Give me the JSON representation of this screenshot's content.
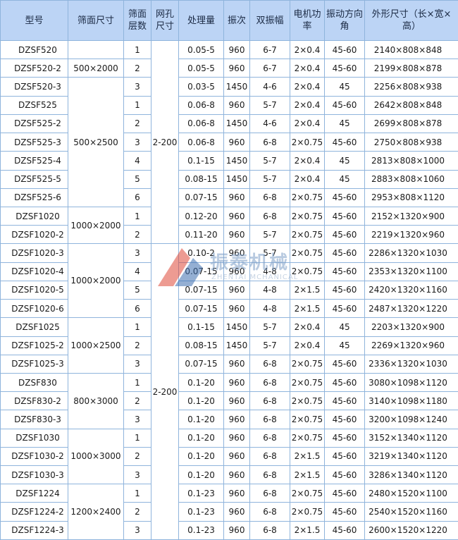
{
  "headers": [
    "型号",
    "筛面尺寸",
    "筛面层数",
    "网孔尺寸",
    "处理量",
    "振次",
    "双振幅",
    "电机功率",
    "振动方向角",
    "外形尺寸（长×宽×高）"
  ],
  "groups": [
    {
      "size": "",
      "rows": [
        {
          "model": "DZSF520",
          "layers": "1",
          "throughput": "0.05-5",
          "freq": "960",
          "amplitude": "6-7",
          "motor": "2×0.4",
          "angle": "45-60",
          "dims": "2140×808×848"
        }
      ]
    },
    {
      "size": "500×2000",
      "rows": [
        {
          "model": "DZSF520-2",
          "layers": "2",
          "throughput": "0.05-5",
          "freq": "960",
          "amplitude": "6-7",
          "motor": "2×0.4",
          "angle": "45-60",
          "dims": "2199×808×878"
        }
      ]
    },
    {
      "size": "500×2500",
      "rows": [
        {
          "model": "DZSF520-3",
          "layers": "3",
          "throughput": "0.03-5",
          "freq": "1450",
          "amplitude": "4-6",
          "motor": "2×0.4",
          "angle": "45",
          "dims": "2256×808×938"
        },
        {
          "model": "DZSF525",
          "layers": "1",
          "throughput": "0.06-8",
          "freq": "960",
          "amplitude": "5-7",
          "motor": "2×0.4",
          "angle": "45-60",
          "dims": "2642×808×848"
        },
        {
          "model": "DZSF525-2",
          "layers": "2",
          "throughput": "0.06-8",
          "freq": "1450",
          "amplitude": "4-6",
          "motor": "2×0.4",
          "angle": "45",
          "dims": "2699×808×878"
        },
        {
          "model": "DZSF525-3",
          "layers": "3",
          "throughput": "0.06-8",
          "freq": "960",
          "amplitude": "6-8",
          "motor": "2×0.75",
          "angle": "45-60",
          "dims": "2750×808×938"
        },
        {
          "model": "DZSF525-4",
          "layers": "4",
          "throughput": "0.1-15",
          "freq": "1450",
          "amplitude": "5-7",
          "motor": "2×0.4",
          "angle": "45",
          "dims": "2813×808×1000"
        },
        {
          "model": "DZSF525-5",
          "layers": "5",
          "throughput": "0.08-15",
          "freq": "1450",
          "amplitude": "5-7",
          "motor": "2×0.4",
          "angle": "45",
          "dims": "2883×808×1060"
        },
        {
          "model": "DZSF525-6",
          "layers": "6",
          "throughput": "0.07-15",
          "freq": "960",
          "amplitude": "6-8",
          "motor": "2×0.75",
          "angle": "45-60",
          "dims": "2953×808×1120"
        }
      ]
    },
    {
      "size": "1000×2000",
      "rows": [
        {
          "model": "DZSF1020",
          "layers": "1",
          "throughput": "0.12-20",
          "freq": "960",
          "amplitude": "6-8",
          "motor": "2×0.75",
          "angle": "45-60",
          "dims": "2152×1320×900"
        },
        {
          "model": "DZSF1020-2",
          "layers": "2",
          "throughput": "0.11-20",
          "freq": "960",
          "amplitude": "5-7",
          "motor": "2×0.75",
          "angle": "45-60",
          "dims": "2219×1320×960"
        }
      ]
    },
    {
      "size": "1000×2000",
      "rows": [
        {
          "model": "DZSF1020-3",
          "layers": "3",
          "throughput": "0.10-2",
          "freq": "960",
          "amplitude": "5-7",
          "motor": "2×0.75",
          "angle": "45-60",
          "dims": "2286×1320×1030"
        },
        {
          "model": "DZSF1020-4",
          "layers": "4",
          "throughput": "0.07-15",
          "freq": "960",
          "amplitude": "4-8",
          "motor": "2×0.75",
          "angle": "45-60",
          "dims": "2353×1320×1100"
        },
        {
          "model": "DZSF1020-5",
          "layers": "5",
          "throughput": "0.07-15",
          "freq": "960",
          "amplitude": "4-8",
          "motor": "2×1.5",
          "angle": "45-60",
          "dims": "2420×1320×1160"
        },
        {
          "model": "DZSF1020-6",
          "layers": "6",
          "throughput": "0.07-15",
          "freq": "960",
          "amplitude": "4-8",
          "motor": "2×1.5",
          "angle": "45-60",
          "dims": "2487×1320×1220"
        }
      ]
    },
    {
      "size": "1000×2500",
      "rows": [
        {
          "model": "DZSF1025",
          "layers": "1",
          "throughput": "0.1-15",
          "freq": "1450",
          "amplitude": "5-7",
          "motor": "2×0.4",
          "angle": "45",
          "dims": "2203×1320×900"
        },
        {
          "model": "DZSF1025-2",
          "layers": "2",
          "throughput": "0.08-15",
          "freq": "1450",
          "amplitude": "5-7",
          "motor": "2×0.4",
          "angle": "45",
          "dims": "2269×1320×960"
        },
        {
          "model": "DZSF1025-3",
          "layers": "3",
          "throughput": "0.07-15",
          "freq": "960",
          "amplitude": "6-8",
          "motor": "2×0.75",
          "angle": "45-60",
          "dims": "2336×1320×1030"
        }
      ]
    },
    {
      "size": "800×3000",
      "rows": [
        {
          "model": "DZSF830",
          "layers": "1",
          "throughput": "0.1-20",
          "freq": "960",
          "amplitude": "6-8",
          "motor": "2×0.75",
          "angle": "45-60",
          "dims": "3080×1098×1120"
        },
        {
          "model": "DZSF830-2",
          "layers": "2",
          "throughput": "0.1-20",
          "freq": "960",
          "amplitude": "6-8",
          "motor": "2×0.75",
          "angle": "45-60",
          "dims": "3140×1098×1180"
        },
        {
          "model": "DZSF830-3",
          "layers": "3",
          "throughput": "0.1-20",
          "freq": "960",
          "amplitude": "6-8",
          "motor": "2×0.75",
          "angle": "45-60",
          "dims": "3200×1098×1240"
        }
      ]
    },
    {
      "size": "1000×3000",
      "rows": [
        {
          "model": "DZSF1030",
          "layers": "1",
          "throughput": "0.1-20",
          "freq": "960",
          "amplitude": "6-8",
          "motor": "2×0.75",
          "angle": "45-60",
          "dims": "3152×1340×1120"
        },
        {
          "model": "DZSF1030-2",
          "layers": "2",
          "throughput": "0.1-20",
          "freq": "960",
          "amplitude": "6-8",
          "motor": "2×1.5",
          "angle": "45-60",
          "dims": "3219×1340×1120"
        },
        {
          "model": "DZSF1030-3",
          "layers": "3",
          "throughput": "0.1-20",
          "freq": "960",
          "amplitude": "6-8",
          "motor": "2×1.5",
          "angle": "45-60",
          "dims": "3286×1340×1120"
        }
      ]
    },
    {
      "size": "1200×2400",
      "rows": [
        {
          "model": "DZSF1224",
          "layers": "1",
          "throughput": "0.1-23",
          "freq": "960",
          "amplitude": "6-8",
          "motor": "2×0.75",
          "angle": "45-60",
          "dims": "2480×1520×1100"
        },
        {
          "model": "DZSF1224-2",
          "layers": "2",
          "throughput": "0.1-23",
          "freq": "960",
          "amplitude": "6-8",
          "motor": "2×0.75",
          "angle": "45-60",
          "dims": "2540×1520×1160"
        },
        {
          "model": "DZSF1224-3",
          "layers": "3",
          "throughput": "0.1-23",
          "freq": "960",
          "amplitude": "6-8",
          "motor": "2×1.5",
          "angle": "45-60",
          "dims": "2600×1520×1220"
        }
      ]
    }
  ],
  "mesh_blocks": [
    {
      "text": "2-200",
      "rows": 11
    },
    {
      "text": "2-200",
      "rows": 17
    }
  ],
  "watermark": {
    "cn": "振泰机械",
    "en": "ZHENTAI MCHANICAL",
    "colors": {
      "red": "#e04a3a",
      "blue": "#3d6fb0"
    }
  }
}
